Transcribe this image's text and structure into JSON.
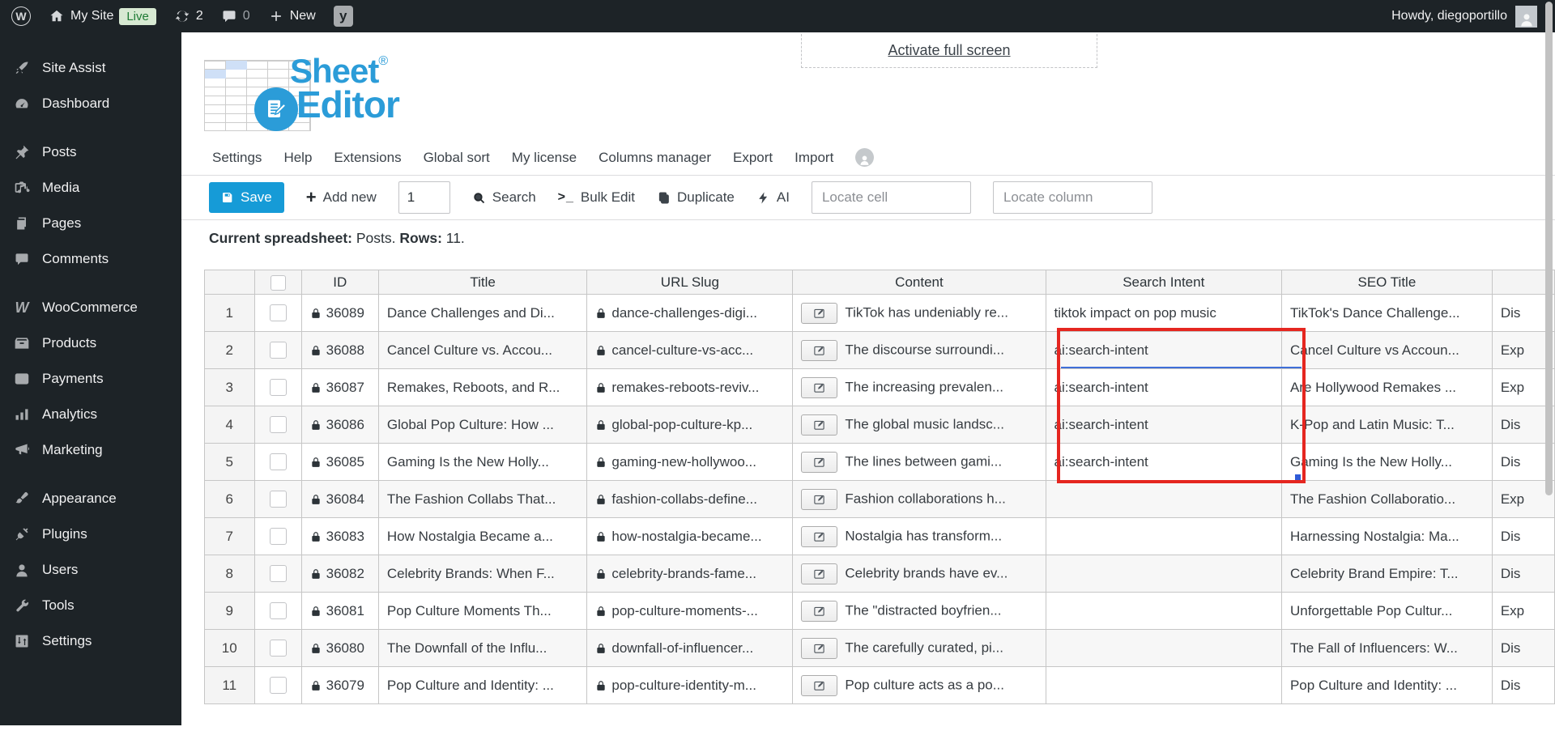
{
  "admin_bar": {
    "site_name": "My Site",
    "live_badge": "Live",
    "update_count": "2",
    "comment_count": "0",
    "new_label": "New",
    "howdy": "Howdy, diegoportillo"
  },
  "sidebar": {
    "items": [
      {
        "label": "Site Assist",
        "icon": "rocket-icon",
        "gap": false
      },
      {
        "label": "Dashboard",
        "icon": "gauge-icon",
        "gap": false
      },
      {
        "label": "Posts",
        "icon": "pin-icon",
        "gap": true
      },
      {
        "label": "Media",
        "icon": "media-icon",
        "gap": false
      },
      {
        "label": "Pages",
        "icon": "pages-icon",
        "gap": false
      },
      {
        "label": "Comments",
        "icon": "comment-icon",
        "gap": false
      },
      {
        "label": "WooCommerce",
        "icon": "woocommerce-icon",
        "gap": true
      },
      {
        "label": "Products",
        "icon": "box-icon",
        "gap": false
      },
      {
        "label": "Payments",
        "icon": "payment-icon",
        "gap": false
      },
      {
        "label": "Analytics",
        "icon": "bar-chart-icon",
        "gap": false
      },
      {
        "label": "Marketing",
        "icon": "megaphone-icon",
        "gap": false
      },
      {
        "label": "Appearance",
        "icon": "brush-icon",
        "gap": true
      },
      {
        "label": "Plugins",
        "icon": "plug-icon",
        "gap": false
      },
      {
        "label": "Users",
        "icon": "user-icon",
        "gap": false
      },
      {
        "label": "Tools",
        "icon": "wrench-icon",
        "gap": false
      },
      {
        "label": "Settings",
        "icon": "sliders-icon",
        "gap": false
      }
    ]
  },
  "header": {
    "logo_line1": "Sheet",
    "logo_reg": "®",
    "logo_line2": "Editor",
    "fullscreen_link": "Activate full screen"
  },
  "plugin_menu": {
    "items": [
      "Settings",
      "Help",
      "Extensions",
      "Global sort",
      "My license",
      "Columns manager",
      "Export",
      "Import"
    ]
  },
  "toolbar": {
    "save_label": "Save",
    "add_new_label": "Add new",
    "rows_input_value": "1",
    "search_label": "Search",
    "bulk_edit_label": "Bulk Edit",
    "duplicate_label": "Duplicate",
    "ai_label": "AI",
    "locate_cell_placeholder": "Locate cell",
    "locate_column_placeholder": "Locate column"
  },
  "status": {
    "label_spreadsheet": "Current spreadsheet:",
    "value_spreadsheet": "Posts.",
    "label_rows": "Rows:",
    "value_rows": "11."
  },
  "table": {
    "headers": [
      "ID",
      "Title",
      "URL Slug",
      "Content",
      "Search Intent",
      "SEO Title",
      ""
    ],
    "rows": [
      {
        "n": "1",
        "id": "36089",
        "title": "Dance Challenges and Di...",
        "slug": "dance-challenges-digi...",
        "content": "TikTok has undeniably re...",
        "search_intent": "tiktok impact on pop music",
        "seo_title": "TikTok's Dance Challenge...",
        "last": "Dis"
      },
      {
        "n": "2",
        "id": "36088",
        "title": "Cancel Culture vs. Accou...",
        "slug": "cancel-culture-vs-acc...",
        "content": "The discourse surroundi...",
        "search_intent": "ai:search-intent",
        "seo_title": "Cancel Culture vs Accoun...",
        "last": "Exp"
      },
      {
        "n": "3",
        "id": "36087",
        "title": "Remakes, Reboots, and R...",
        "slug": "remakes-reboots-reviv...",
        "content": "The increasing prevalen...",
        "search_intent": "ai:search-intent",
        "seo_title": "Are Hollywood Remakes ...",
        "last": "Exp"
      },
      {
        "n": "4",
        "id": "36086",
        "title": "Global Pop Culture: How ...",
        "slug": "global-pop-culture-kp...",
        "content": "The global music landsc...",
        "search_intent": "ai:search-intent",
        "seo_title": "K-Pop and Latin Music: T...",
        "last": "Dis"
      },
      {
        "n": "5",
        "id": "36085",
        "title": "Gaming Is the New Holly...",
        "slug": "gaming-new-hollywoo...",
        "content": "The lines between gami...",
        "search_intent": "ai:search-intent",
        "seo_title": "Gaming Is the New Holly...",
        "last": "Dis"
      },
      {
        "n": "6",
        "id": "36084",
        "title": "The Fashion Collabs That...",
        "slug": "fashion-collabs-define...",
        "content": "Fashion collaborations h...",
        "search_intent": "",
        "seo_title": "The Fashion Collaboratio...",
        "last": "Exp"
      },
      {
        "n": "7",
        "id": "36083",
        "title": "How Nostalgia Became a...",
        "slug": "how-nostalgia-became...",
        "content": "Nostalgia has transform...",
        "search_intent": "",
        "seo_title": "Harnessing Nostalgia: Ma...",
        "last": "Dis"
      },
      {
        "n": "8",
        "id": "36082",
        "title": "Celebrity Brands: When F...",
        "slug": "celebrity-brands-fame...",
        "content": "Celebrity brands have ev...",
        "search_intent": "",
        "seo_title": "Celebrity Brand Empire: T...",
        "last": "Dis"
      },
      {
        "n": "9",
        "id": "36081",
        "title": "Pop Culture Moments Th...",
        "slug": "pop-culture-moments-...",
        "content": "The \"distracted boyfrien...",
        "search_intent": "",
        "seo_title": "Unforgettable Pop Cultur...",
        "last": "Exp"
      },
      {
        "n": "10",
        "id": "36080",
        "title": "The Downfall of the Influ...",
        "slug": "downfall-of-influencer...",
        "content": "The carefully curated, pi...",
        "search_intent": "",
        "seo_title": "The Fall of Influencers: W...",
        "last": "Dis"
      },
      {
        "n": "11",
        "id": "36079",
        "title": "Pop Culture and Identity: ...",
        "slug": "pop-culture-identity-m...",
        "content": "Pop culture acts as a po...",
        "search_intent": "",
        "seo_title": "Pop Culture and Identity: ...",
        "last": "Dis"
      }
    ]
  },
  "colors": {
    "accent_blue": "#169bd7",
    "logo_blue": "#2b9cd8",
    "highlight_red": "#e52620",
    "selection_blue": "#3f6fd8",
    "live_green": "#1e7a34",
    "admin_dark": "#1d2327"
  }
}
